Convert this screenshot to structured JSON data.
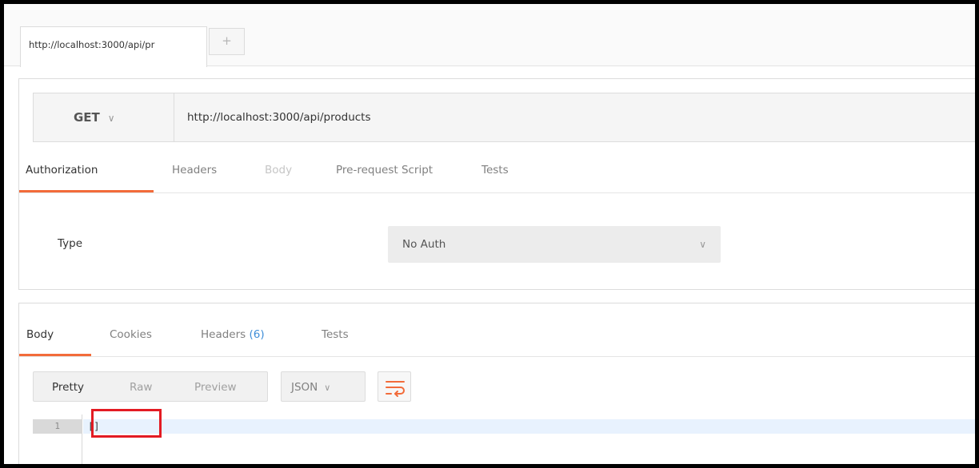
{
  "tabs": {
    "request_tab_label": "http://localhost:3000/api/pr",
    "new_tab_symbol": "+"
  },
  "request": {
    "method": "GET",
    "url": "http://localhost:3000/api/products",
    "tabs": [
      {
        "label": "Authorization",
        "state": "active"
      },
      {
        "label": "Headers",
        "state": "normal"
      },
      {
        "label": "Body",
        "state": "disabled"
      },
      {
        "label": "Pre-request Script",
        "state": "normal"
      },
      {
        "label": "Tests",
        "state": "normal"
      }
    ],
    "auth": {
      "type_label": "Type",
      "type_value": "No Auth"
    }
  },
  "response": {
    "tabs": [
      {
        "label": "Body",
        "state": "active"
      },
      {
        "label": "Cookies",
        "state": "normal"
      },
      {
        "label": "Headers",
        "count": "(6)",
        "state": "normal"
      },
      {
        "label": "Tests",
        "state": "normal"
      }
    ],
    "view_modes": [
      {
        "label": "Pretty",
        "state": "active"
      },
      {
        "label": "Raw",
        "state": "normal"
      },
      {
        "label": "Preview",
        "state": "normal"
      }
    ],
    "format": "JSON",
    "editor": {
      "line_number": "1",
      "content": "[]"
    }
  },
  "colors": {
    "accent": "#f26b3a",
    "count": "#3f8ed8",
    "highlight_box": "#e31b23"
  },
  "icons": {
    "method_dropdown": "chevron-down-icon",
    "auth_dropdown": "chevron-down-icon",
    "format_dropdown": "chevron-down-icon",
    "wrap": "wrap-lines-icon"
  }
}
